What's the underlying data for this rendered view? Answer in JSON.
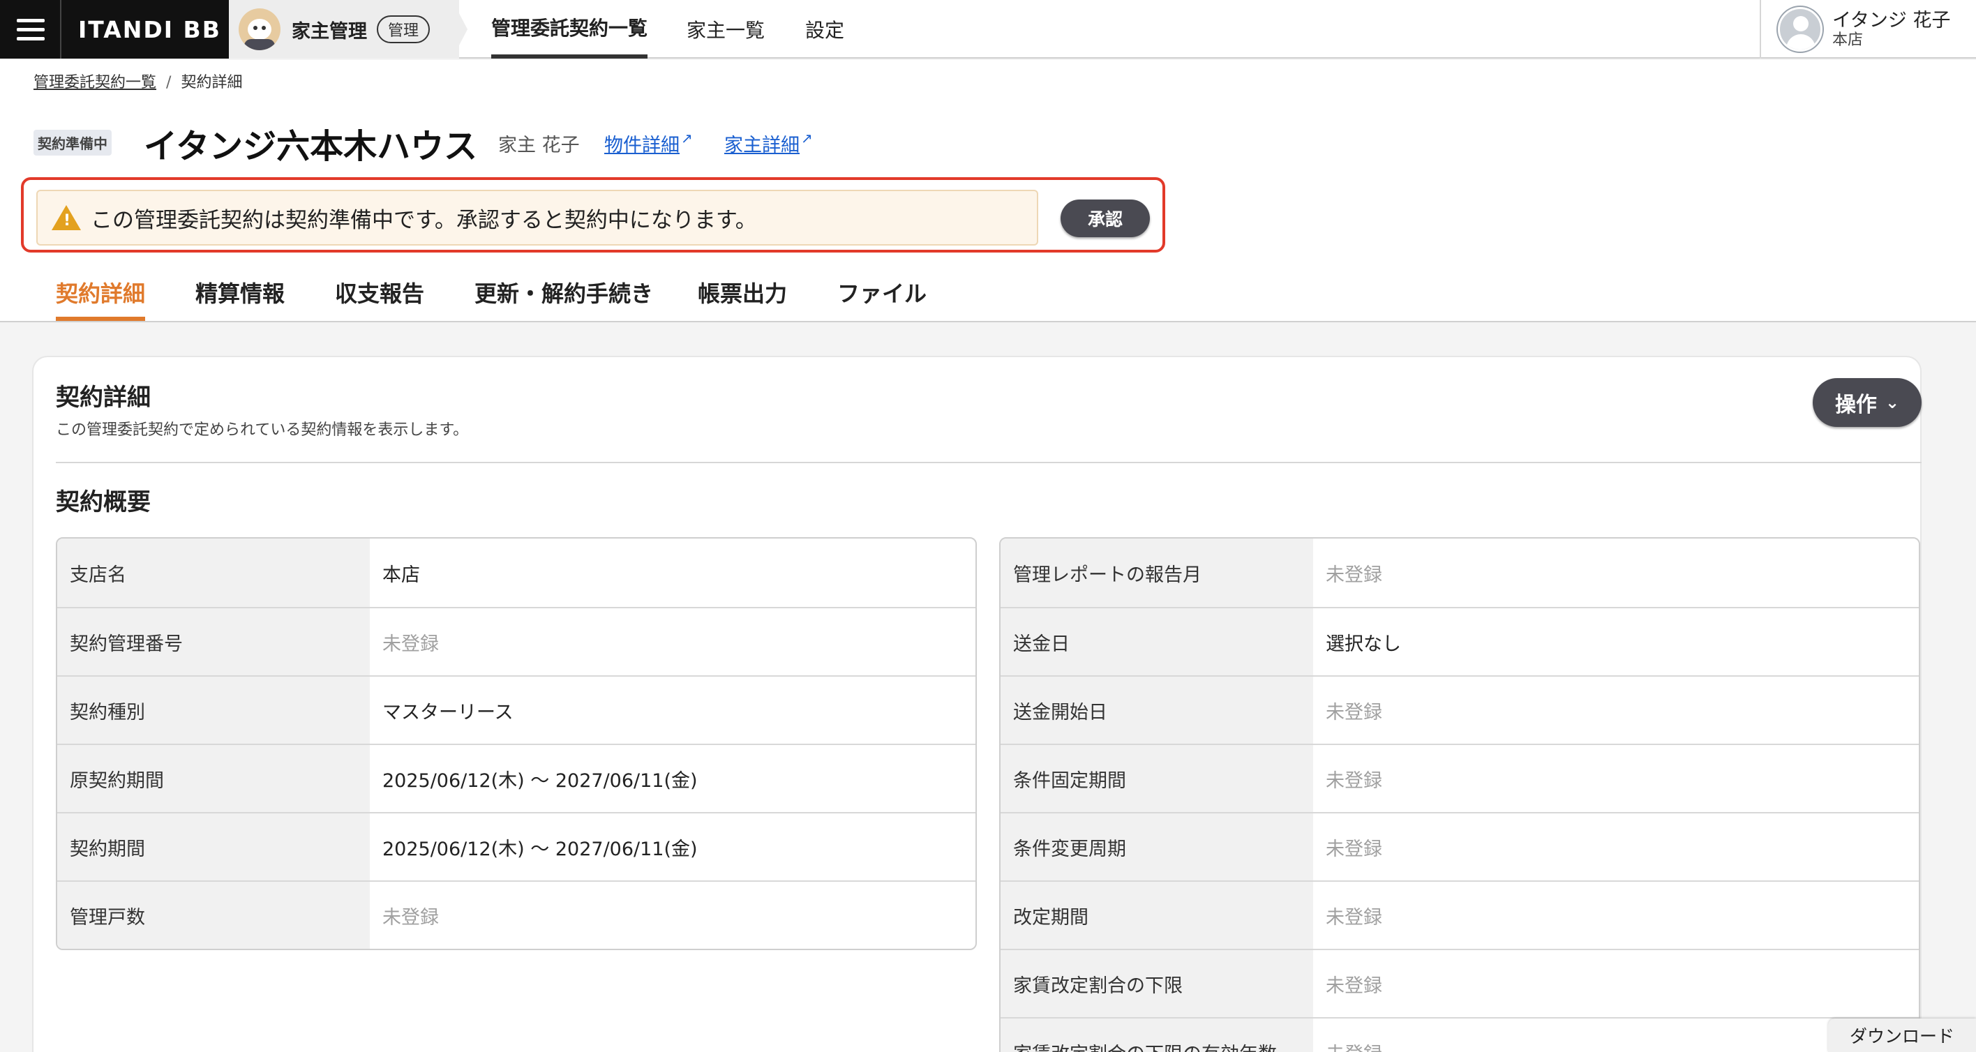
{
  "topnav": {
    "logo": "ITANDI BB",
    "app_name": "家主管理",
    "app_badge": "管理",
    "tabs": [
      {
        "label": "管理委託契約一覧",
        "active": true
      },
      {
        "label": "家主一覧"
      },
      {
        "label": "設定"
      }
    ],
    "user": {
      "name": "イタンジ 花子",
      "branch": "本店"
    }
  },
  "breadcrumb": {
    "parent": "管理委託契約一覧",
    "current": "契約詳細"
  },
  "header": {
    "status": "契約準備中",
    "title": "イタンジ六本木ハウス",
    "owner": "家主 花子",
    "links": [
      {
        "label": "物件詳細"
      },
      {
        "label": "家主詳細"
      }
    ]
  },
  "alert": {
    "message": "この管理委託契約は契約準備中です。承認すると契約中になります。",
    "button": "承認"
  },
  "subtabs": [
    "契約詳細",
    "精算情報",
    "収支報告",
    "更新・解約手続き",
    "帳票出力",
    "ファイル"
  ],
  "card": {
    "title": "契約詳細",
    "description": "この管理委託契約で定められている契約情報を表示します。",
    "ops_button": "操作",
    "section_title": "契約概要",
    "left_rows": [
      {
        "key": "支店名",
        "value": "本店"
      },
      {
        "key": "契約管理番号",
        "value": "未登録",
        "empty": true
      },
      {
        "key": "契約種別",
        "value": "マスターリース"
      },
      {
        "key": "原契約期間",
        "value": "2025/06/12(木) 〜 2027/06/11(金)"
      },
      {
        "key": "契約期間",
        "value": "2025/06/12(木) 〜 2027/06/11(金)"
      },
      {
        "key": "管理戸数",
        "value": "未登録",
        "empty": true
      }
    ],
    "right_rows": [
      {
        "key": "管理レポートの報告月",
        "value": "未登録",
        "empty": true
      },
      {
        "key": "送金日",
        "value": "選択なし"
      },
      {
        "key": "送金開始日",
        "value": "未登録",
        "empty": true
      },
      {
        "key": "条件固定期間",
        "value": "未登録",
        "empty": true
      },
      {
        "key": "条件変更周期",
        "value": "未登録",
        "empty": true
      },
      {
        "key": "改定期間",
        "value": "未登録",
        "empty": true
      },
      {
        "key": "家賃改定割合の下限",
        "value": "未登録",
        "empty": true
      },
      {
        "key": "家賃改定割合の下限の有効年数",
        "value": "未登録",
        "empty": true
      }
    ]
  },
  "download_button": "ダウンロード",
  "colors": {
    "accent": "#e07a2c",
    "alert_border": "#e23a2a",
    "link": "#1a5fd0",
    "button_dark": "#4a4a52"
  }
}
